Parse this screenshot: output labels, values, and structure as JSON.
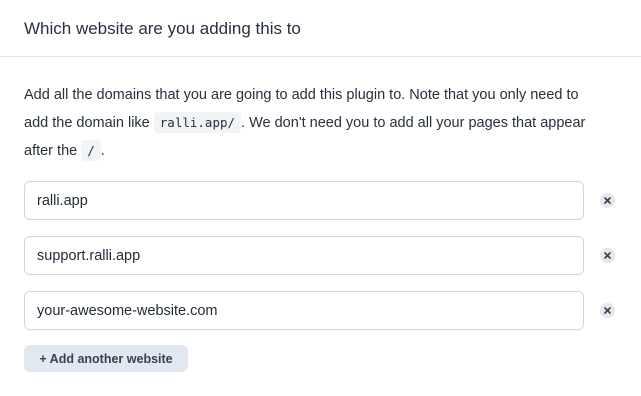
{
  "header": {
    "title": "Which website are you adding this to"
  },
  "description": {
    "part1": "Add all the domains that you are going to add this plugin to. Note that you only need to add the domain like ",
    "code1": "ralli.app/",
    "part2": ". We don't need you to add all your pages that appear after the ",
    "code2": "/",
    "part3": "."
  },
  "domains": [
    {
      "value": "ralli.app",
      "remove_icon": "close-icon"
    },
    {
      "value": "support.ralli.app",
      "remove_icon": "close-icon"
    },
    {
      "value": "your-awesome-website.com",
      "remove_icon": "close-icon"
    }
  ],
  "add_button": {
    "label": "+ Add another website"
  },
  "colors": {
    "border": "#d1d5db",
    "button_bg": "#e2e8f0",
    "text": "#27303f"
  }
}
